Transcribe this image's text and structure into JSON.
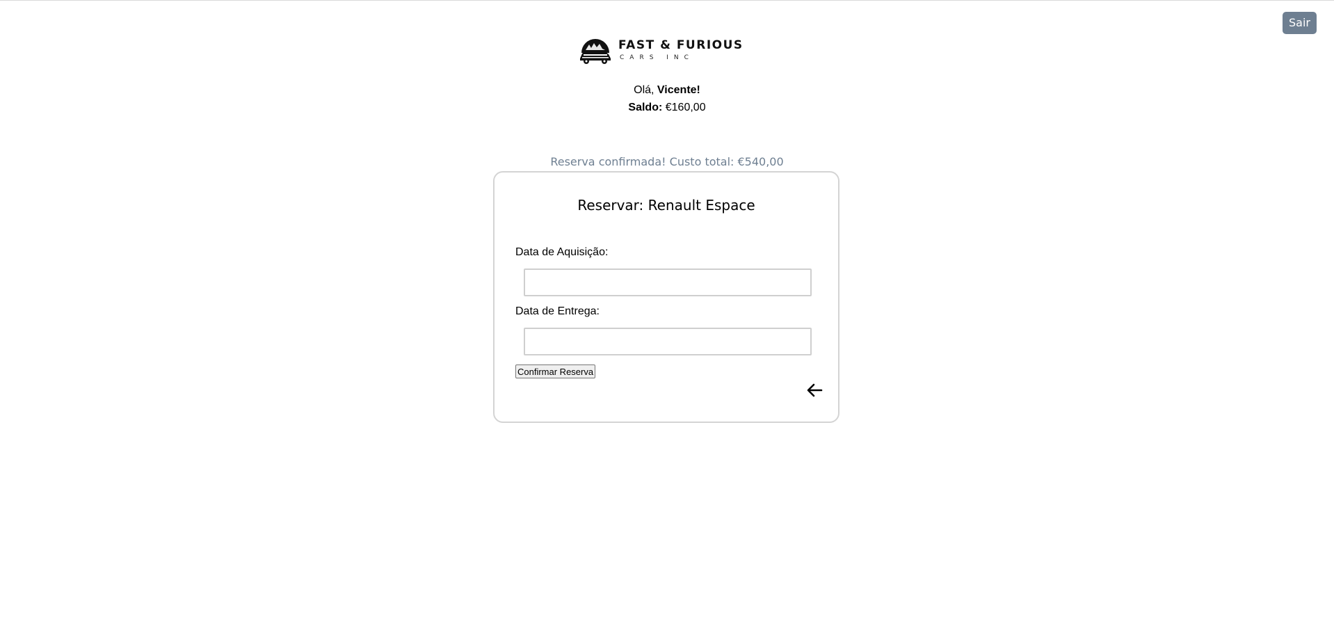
{
  "header": {
    "logout_label": "Sair",
    "logo": {
      "title": "FAST & FURIOUS",
      "subtitle": "CARS INC",
      "icon": "car-emblem-icon"
    }
  },
  "user": {
    "greeting_prefix": "Olá,",
    "name": "Vicente",
    "greeting_suffix": "!",
    "balance_label": "Saldo:",
    "balance_value": "€160,00"
  },
  "status": {
    "message": "Reserva confirmada! Custo total: €540,00"
  },
  "booking_form": {
    "title": "Reservar: Renault Espace",
    "start_date_label": "Data de Aquisição:",
    "start_date_value": "",
    "end_date_label": "Data de Entrega:",
    "end_date_value": "",
    "confirm_label": "Confirmar Reserva",
    "back_icon": "arrow-left-icon"
  },
  "colors": {
    "accent": "#6e7f91",
    "card_border": "#d4d4d4"
  }
}
